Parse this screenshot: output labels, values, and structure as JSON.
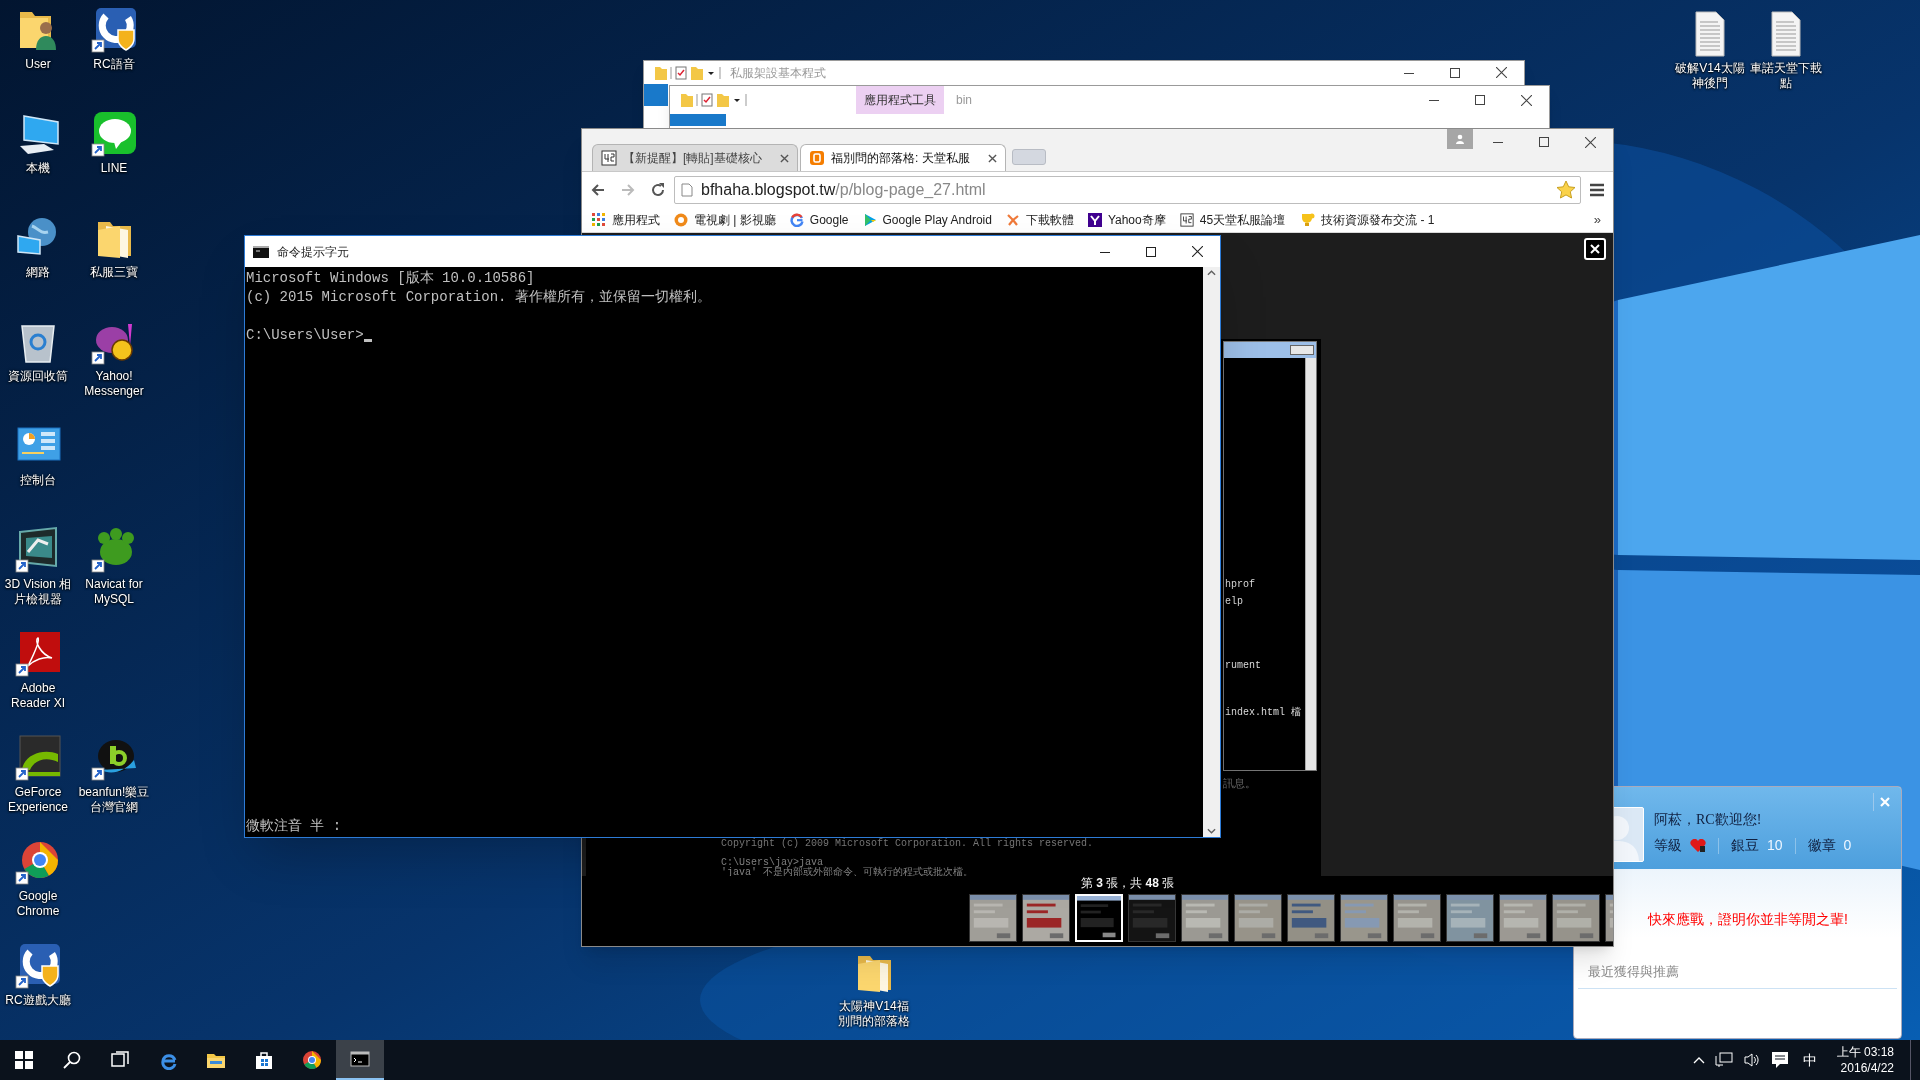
{
  "desktop": {
    "icon_rows": [
      [
        {
          "label": "User",
          "kind": "user-folder",
          "shortcut": false
        },
        {
          "label": "RC語音",
          "kind": "shield-app",
          "shortcut": true
        }
      ],
      [
        {
          "label": "本機",
          "kind": "computer",
          "shortcut": false
        },
        {
          "label": "LINE",
          "kind": "chat",
          "shortcut": true
        }
      ],
      [
        {
          "label": "網路",
          "kind": "network",
          "shortcut": false
        },
        {
          "label": "私服三寶",
          "kind": "folder",
          "shortcut": false
        }
      ],
      [
        {
          "label": "資源回收筒",
          "kind": "recycle-bin",
          "shortcut": false
        },
        {
          "label": "Yahoo! Messenger",
          "kind": "messenger",
          "shortcut": true
        }
      ],
      [
        {
          "label": "控制台",
          "kind": "control-panel",
          "shortcut": false
        }
      ],
      [
        {
          "label": "3D Vision 相片檢視器",
          "kind": "viewer",
          "shortcut": true
        },
        {
          "label": "Navicat for MySQL",
          "kind": "blob",
          "shortcut": true
        }
      ],
      [
        {
          "label": "Adobe Reader XI",
          "kind": "pdf",
          "shortcut": true
        }
      ],
      [
        {
          "label": "GeForce Experience",
          "kind": "swirl",
          "shortcut": true
        },
        {
          "label": "beanfun!樂豆台灣官網",
          "kind": "arrow-ball",
          "shortcut": true
        }
      ],
      [
        {
          "label": "Google Chrome",
          "kind": "browser",
          "shortcut": true
        }
      ],
      [
        {
          "label": "RC遊戲大廳",
          "kind": "shield-app",
          "shortcut": true
        }
      ]
    ],
    "top_right_icons": [
      {
        "label": "破解V14太陽神後門",
        "kind": "document",
        "shortcut": false
      },
      {
        "label": "車諾天堂下載點",
        "kind": "document",
        "shortcut": false
      }
    ],
    "bottom_icons": [
      {
        "label": "太陽神V14福別問的部落格",
        "kind": "folder",
        "shortcut": false
      }
    ]
  },
  "explorer_back": {
    "title": "私服架設基本程式"
  },
  "explorer_front": {
    "context_tab": "應用程式工具",
    "title": "bin"
  },
  "notification": {
    "greeting": "阿菘，RC歡迎您!",
    "stats": [
      {
        "label": "等級",
        "kind": "heart"
      },
      {
        "label": "銀豆",
        "kind": "count",
        "value": "10"
      },
      {
        "label": "徽章",
        "kind": "count",
        "value": "0"
      }
    ],
    "message": "快來應戰，證明你並非等閒之輩!",
    "section": "最近獲得與推薦"
  },
  "browser": {
    "tabs": [
      {
        "title": "【新提醒】[轉貼]基礎核心",
        "kind": "forum",
        "selected": false
      },
      {
        "title": "福別問的部落格: 天堂私服",
        "kind": "blog",
        "selected": true
      }
    ],
    "address": {
      "host": "bfhaha.blogspot.tw",
      "path": "/p/blog-page_27.html"
    },
    "bookmarks": [
      {
        "label": "應用程式",
        "kind": "grid"
      },
      {
        "label": "電視劇 | 影視廳",
        "kind": "badge"
      },
      {
        "label": "Google",
        "kind": "google"
      },
      {
        "label": "Google Play Android",
        "kind": "play"
      },
      {
        "label": "下載軟體",
        "kind": "sprite"
      },
      {
        "label": "Yahoo奇摩",
        "kind": "yahoo"
      },
      {
        "label": "45天堂私服論壇",
        "kind": "forum"
      },
      {
        "label": "技術資源發布交流 - 1",
        "kind": "cup"
      }
    ],
    "bookmarks_overflow": "»",
    "lightbox": {
      "image": {
        "console_lines": [
          "Copyright (c) 2009 Microsoft Corporation.  All rights reserved.",
          "C:\\Users\\jay>java",
          "'java' 不是內部或外部命令、可執行的程式或批次檔。"
        ],
        "window_lines": [
          "hprof",
          "elp",
          "rument",
          "index.html 檔"
        ],
        "note": "訊息。"
      },
      "caption": "第 **3** 張，共 **48** 張",
      "thumbnails": [
        {
          "selected": false
        },
        {
          "selected": false
        },
        {
          "selected": true
        },
        {
          "selected": false
        },
        {
          "selected": false
        },
        {
          "selected": false
        },
        {
          "selected": false
        },
        {
          "selected": false
        },
        {
          "selected": false
        },
        {
          "selected": false
        },
        {
          "selected": false
        },
        {
          "selected": false
        },
        {
          "selected": false
        }
      ]
    }
  },
  "console": {
    "title": "命令提示字元",
    "lines": [
      "Microsoft Windows [版本 10.0.10586]",
      "(c) 2015 Microsoft Corporation. 著作權所有，並保留一切權利。"
    ],
    "prompt": "C:\\Users\\User>",
    "ime_status": "微軟注音 半 :"
  },
  "taskbar": {
    "apps": [
      {
        "kind": "start",
        "active": false
      },
      {
        "kind": "search",
        "active": false
      },
      {
        "kind": "task-view",
        "active": false
      },
      {
        "kind": "edge",
        "active": false
      },
      {
        "kind": "explorer",
        "active": false
      },
      {
        "kind": "store",
        "active": false
      },
      {
        "kind": "browser",
        "active": false
      },
      {
        "kind": "console",
        "active": true
      }
    ],
    "ime": "中",
    "time": "上午 03:18",
    "date": "2016/4/22"
  }
}
